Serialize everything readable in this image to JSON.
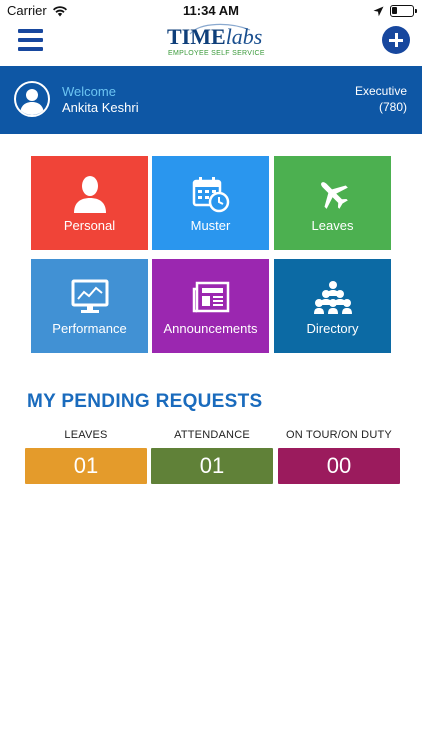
{
  "status_bar": {
    "carrier": "Carrier",
    "time": "11:34 AM",
    "icons": [
      "wifi-icon",
      "location-arrow-icon",
      "battery-icon"
    ]
  },
  "nav": {
    "menu_icon": "hamburger-icon",
    "logo": {
      "line1_time": "TIME",
      "line1_labs": "labs",
      "line2": "EMPLOYEE SELF SERVICE"
    },
    "add_icon": "plus-icon"
  },
  "profile": {
    "welcome": "Welcome",
    "name": "Ankita Keshri",
    "role": "Executive",
    "code": "(780)",
    "colors": {
      "banner": "#0e57a5",
      "welcome": "#6cc4f2"
    }
  },
  "tiles": [
    {
      "label": "Personal",
      "icon": "person-icon",
      "color": "#f04438"
    },
    {
      "label": "Muster",
      "icon": "calendar-clock-icon",
      "color": "#2a96ee"
    },
    {
      "label": "Leaves",
      "icon": "airplane-icon",
      "color": "#4cb050"
    },
    {
      "label": "Performance",
      "icon": "monitor-chart-icon",
      "color": "#4191d4"
    },
    {
      "label": "Announcements",
      "icon": "newspaper-icon",
      "color": "#9b27b0"
    },
    {
      "label": "Directory",
      "icon": "group-icon",
      "color": "#0c6aa4"
    }
  ],
  "pending": {
    "title": "MY PENDING REQUESTS",
    "items": [
      {
        "label": "LEAVES",
        "count": "01",
        "color": "#e49b2b"
      },
      {
        "label": "ATTENDANCE",
        "count": "01",
        "color": "#608138"
      },
      {
        "label": "ON TOUR/ON DUTY",
        "count": "00",
        "color": "#9b1b5d"
      }
    ]
  }
}
